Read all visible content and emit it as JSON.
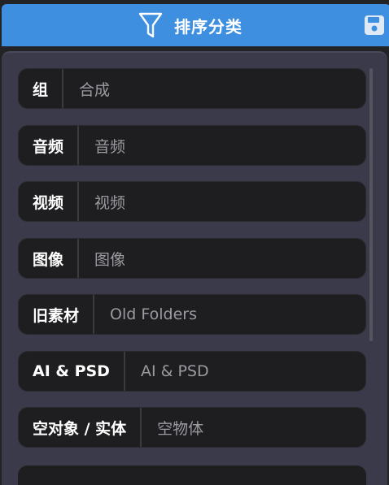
{
  "header": {
    "title": "排序分类",
    "filter_icon": "funnel-icon",
    "save_icon": "save-icon",
    "accent_color": "#3f8fe0"
  },
  "rows": [
    {
      "key": "组",
      "value": "合成"
    },
    {
      "key": "音频",
      "value": "音频"
    },
    {
      "key": "视频",
      "value": "视频"
    },
    {
      "key": "图像",
      "value": "图像"
    },
    {
      "key": "旧素材",
      "value": "Old Folders"
    },
    {
      "key": "AI & PSD",
      "value": "AI & PSD"
    },
    {
      "key": "空对象 / 实体",
      "value": "空物体"
    }
  ]
}
